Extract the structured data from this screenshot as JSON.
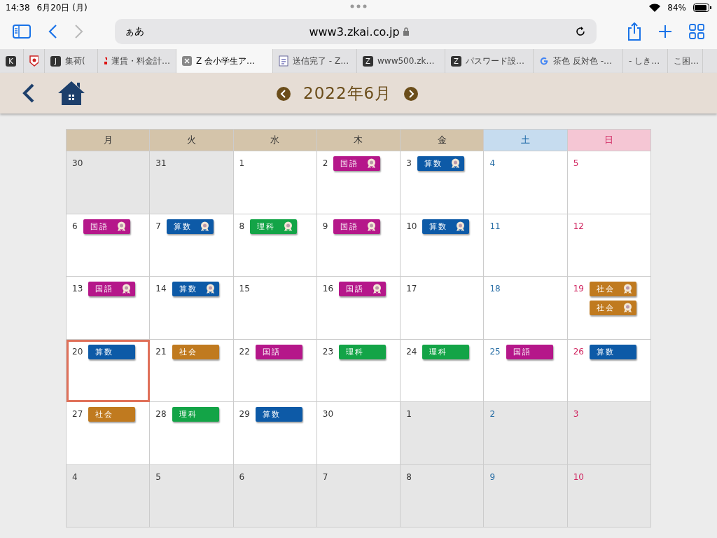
{
  "status_bar": {
    "time": "14:38",
    "date": "6月20日 (月)",
    "battery": "84%"
  },
  "toolbar": {
    "text_size": "ぁあ",
    "url": "www3.zkai.co.jp"
  },
  "browser_tabs": [
    {
      "kind": "letter",
      "icon_text": "K",
      "selected": false
    },
    {
      "kind": "favicon",
      "selected": false
    },
    {
      "kind": "letter",
      "icon_text": "J",
      "label": "集荷(",
      "selected": false
    },
    {
      "kind": "jp",
      "label": "運賃・料金計…",
      "selected": false
    },
    {
      "kind": "close",
      "label": "Z 会小学生ア…",
      "selected": true
    },
    {
      "kind": "doc",
      "label": "送信完了 - Z…",
      "selected": false
    },
    {
      "kind": "letter",
      "icon_text": "Z",
      "label": "www500.zk…",
      "selected": false
    },
    {
      "kind": "letter",
      "icon_text": "Z",
      "label": "パスワード設…",
      "selected": false
    },
    {
      "kind": "google",
      "label": "茶色 反対色 -…",
      "selected": false
    },
    {
      "kind": "none",
      "label": "- しき…",
      "selected": false
    },
    {
      "kind": "none",
      "label": "こ困…",
      "selected": false
    }
  ],
  "header": {
    "month": "2022年6月"
  },
  "calendar": {
    "weekdays": [
      "月",
      "火",
      "水",
      "木",
      "金",
      "土",
      "日"
    ],
    "weeks": [
      [
        {
          "day": "30",
          "in_month": false
        },
        {
          "day": "31",
          "in_month": false
        },
        {
          "day": "1",
          "in_month": true
        },
        {
          "day": "2",
          "in_month": true,
          "events": [
            {
              "label": "国語",
              "color": "#b5178a",
              "medal": true
            }
          ]
        },
        {
          "day": "3",
          "in_month": true,
          "events": [
            {
              "label": "算数",
              "color": "#0d5aa7",
              "medal": true
            }
          ]
        },
        {
          "day": "4",
          "in_month": true
        },
        {
          "day": "5",
          "in_month": true
        }
      ],
      [
        {
          "day": "6",
          "in_month": true,
          "events": [
            {
              "label": "国語",
              "color": "#b5178a",
              "medal": true
            }
          ]
        },
        {
          "day": "7",
          "in_month": true,
          "events": [
            {
              "label": "算数",
              "color": "#0d5aa7",
              "medal": true
            }
          ]
        },
        {
          "day": "8",
          "in_month": true,
          "events": [
            {
              "label": "理科",
              "color": "#13a447",
              "medal": true
            }
          ]
        },
        {
          "day": "9",
          "in_month": true,
          "events": [
            {
              "label": "国語",
              "color": "#b5178a",
              "medal": true
            }
          ]
        },
        {
          "day": "10",
          "in_month": true,
          "events": [
            {
              "label": "算数",
              "color": "#0d5aa7",
              "medal": true
            }
          ]
        },
        {
          "day": "11",
          "in_month": true
        },
        {
          "day": "12",
          "in_month": true
        }
      ],
      [
        {
          "day": "13",
          "in_month": true,
          "events": [
            {
              "label": "国語",
              "color": "#b5178a",
              "medal": true
            }
          ]
        },
        {
          "day": "14",
          "in_month": true,
          "events": [
            {
              "label": "算数",
              "color": "#0d5aa7",
              "medal": true
            }
          ]
        },
        {
          "day": "15",
          "in_month": true
        },
        {
          "day": "16",
          "in_month": true,
          "events": [
            {
              "label": "国語",
              "color": "#b5178a",
              "medal": true
            }
          ]
        },
        {
          "day": "17",
          "in_month": true
        },
        {
          "day": "18",
          "in_month": true
        },
        {
          "day": "19",
          "in_month": true,
          "events": [
            {
              "label": "社会",
              "color": "#c07a1f",
              "medal": true
            },
            {
              "label": "社会",
              "color": "#c07a1f",
              "medal": true
            }
          ]
        }
      ],
      [
        {
          "day": "20",
          "in_month": true,
          "selected": true,
          "events": [
            {
              "label": "算数",
              "color": "#0d5aa7",
              "medal": false
            }
          ]
        },
        {
          "day": "21",
          "in_month": true,
          "events": [
            {
              "label": "社会",
              "color": "#c07a1f",
              "medal": false
            }
          ]
        },
        {
          "day": "22",
          "in_month": true,
          "events": [
            {
              "label": "国語",
              "color": "#b5178a",
              "medal": false
            }
          ]
        },
        {
          "day": "23",
          "in_month": true,
          "events": [
            {
              "label": "理科",
              "color": "#13a447",
              "medal": false
            }
          ]
        },
        {
          "day": "24",
          "in_month": true,
          "events": [
            {
              "label": "理科",
              "color": "#13a447",
              "medal": false
            }
          ]
        },
        {
          "day": "25",
          "in_month": true,
          "events": [
            {
              "label": "国語",
              "color": "#b5178a",
              "medal": false
            }
          ]
        },
        {
          "day": "26",
          "in_month": true,
          "events": [
            {
              "label": "算数",
              "color": "#0d5aa7",
              "medal": false
            }
          ]
        }
      ],
      [
        {
          "day": "27",
          "in_month": true,
          "events": [
            {
              "label": "社会",
              "color": "#c07a1f",
              "medal": false
            }
          ]
        },
        {
          "day": "28",
          "in_month": true,
          "events": [
            {
              "label": "理科",
              "color": "#13a447",
              "medal": false
            }
          ]
        },
        {
          "day": "29",
          "in_month": true,
          "events": [
            {
              "label": "算数",
              "color": "#0d5aa7",
              "medal": false
            }
          ]
        },
        {
          "day": "30",
          "in_month": true
        },
        {
          "day": "1",
          "in_month": false
        },
        {
          "day": "2",
          "in_month": false
        },
        {
          "day": "3",
          "in_month": false
        }
      ],
      [
        {
          "day": "4",
          "in_month": false
        },
        {
          "day": "5",
          "in_month": false
        },
        {
          "day": "6",
          "in_month": false
        },
        {
          "day": "7",
          "in_month": false
        },
        {
          "day": "8",
          "in_month": false
        },
        {
          "day": "9",
          "in_month": false
        },
        {
          "day": "10",
          "in_month": false
        }
      ]
    ]
  }
}
